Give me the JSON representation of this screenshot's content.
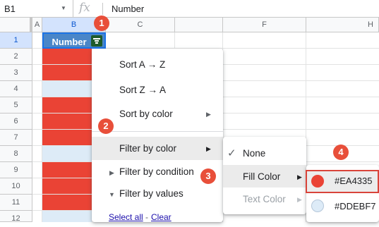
{
  "formula_bar": {
    "cell_ref": "B1",
    "fx_label": "fx",
    "content": "Number"
  },
  "columns": [
    "A",
    "B",
    "C",
    "F",
    "H"
  ],
  "rows": [
    "1",
    "2",
    "3",
    "4",
    "5",
    "6",
    "7",
    "8",
    "9",
    "10",
    "11",
    "12"
  ],
  "header_cell": {
    "label": "Number"
  },
  "colors": {
    "red": "#EA4335",
    "light_blue": "#DDEBF7",
    "header_blue": "#4A86C8",
    "badge": "#E84F3A"
  },
  "menu": {
    "sort_az": "Sort A → Z",
    "sort_za": "Sort Z → A",
    "sort_by_color": "Sort by color",
    "filter_by_color": "Filter by color",
    "filter_by_condition": "Filter by condition",
    "filter_by_values": "Filter by values",
    "select_all": "Select all",
    "sep": "-",
    "clear": "Clear"
  },
  "submenu": {
    "checkmark": "✓",
    "none": "None",
    "fill_color": "Fill Color",
    "text_color": "Text Color"
  },
  "colors_menu": {
    "first": "#EA4335",
    "second": "#DDEBF7"
  },
  "badges": [
    "1",
    "2",
    "3",
    "4"
  ]
}
